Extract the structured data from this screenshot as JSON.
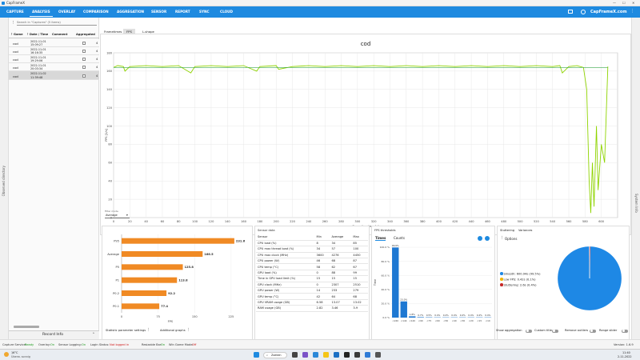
{
  "window_title": "CapFrameX",
  "nav": {
    "tabs": [
      "CAPTURE",
      "ANALYSIS",
      "OVERLAY",
      "COMPARISON",
      "AGGREGATION",
      "SENSOR",
      "REPORT",
      "SYNC",
      "CLOUD"
    ],
    "active": "ANALYSIS",
    "brand": "CapFrameX.com"
  },
  "left": {
    "search_placeholder": "Search in \"Captures\" (5 items)",
    "columns": [
      "Game",
      "Date / Time",
      "Comment",
      "Aggregated"
    ],
    "rows": [
      {
        "game": "cod",
        "date": "2022-11-01",
        "time": "15:09:27",
        "n": "4"
      },
      {
        "game": "cod",
        "date": "2022-11-01",
        "time": "16:16:35",
        "n": "4"
      },
      {
        "game": "cod",
        "date": "2022-11-01",
        "time": "19:29:06",
        "n": "4"
      },
      {
        "game": "cod",
        "date": "2022-11-01",
        "time": "20:03:34",
        "n": "4"
      },
      {
        "game": "cod",
        "date": "2022-11-02",
        "time": "11:39:48",
        "n": "4"
      }
    ],
    "record_info": "Record Info",
    "observed_label": "Observed directory"
  },
  "right_strip": "System Info",
  "graph": {
    "tabs": [
      "Frametimes",
      "FPS",
      "L-shape"
    ],
    "active_tab": "FPS",
    "title": "cod",
    "filter_label": "Filter mode",
    "filter_value": "Average"
  },
  "chart_data": [
    {
      "type": "line",
      "title": "cod",
      "xlabel": "Recording time [s]",
      "ylabel": "FPS [1/s]",
      "xlim": [
        0,
        620
      ],
      "ylim": [
        0,
        180
      ],
      "xticks": [
        0,
        20,
        40,
        60,
        80,
        100,
        120,
        140,
        160,
        180,
        200,
        220,
        240,
        260,
        280,
        300,
        320,
        340,
        360,
        380,
        400,
        420,
        440,
        460,
        480,
        500,
        520,
        540,
        560,
        580,
        600
      ],
      "yticks": [
        0,
        20,
        40,
        60,
        80,
        100,
        120,
        140,
        160,
        180
      ],
      "series": [
        {
          "name": "FPS",
          "color": "#8fd400",
          "x": [
            0,
            5,
            12,
            14,
            20,
            40,
            60,
            80,
            95,
            100,
            120,
            140,
            160,
            176,
            180,
            200,
            203,
            220,
            240,
            260,
            280,
            300,
            320,
            340,
            360,
            380,
            400,
            420,
            440,
            460,
            480,
            500,
            520,
            540,
            549,
            552,
            560,
            570,
            578,
            582,
            585,
            587,
            589,
            591,
            594,
            596,
            600,
            604,
            608
          ],
          "y": [
            164,
            166,
            165,
            160,
            165,
            166,
            165,
            166,
            158,
            165,
            166,
            165,
            166,
            160,
            165,
            166,
            162,
            165,
            166,
            165,
            166,
            165,
            166,
            165,
            166,
            165,
            166,
            165,
            166,
            165,
            166,
            165,
            166,
            165,
            166,
            158,
            165,
            166,
            164,
            140,
            40,
            5,
            60,
            12,
            100,
            30,
            80,
            60,
            165
          ]
        },
        {
          "name": "Avg FPS",
          "color": "#3aa84a",
          "x": [
            0,
            608
          ],
          "y": [
            164,
            164
          ]
        }
      ],
      "legend": "bottom-right"
    },
    {
      "type": "bar",
      "categories": [
        "P95",
        "Average",
        "P5",
        "P1",
        "P0.2",
        "P0.1"
      ],
      "values": [
        231.6,
        166.5,
        125.8,
        113.8,
        92.2,
        77.4
      ],
      "xticks": [
        0,
        75,
        150,
        225
      ],
      "xlim": [
        0,
        240
      ],
      "color": "#f08a24"
    },
    {
      "type": "bar",
      "title": "FPS thresholds",
      "ylabel": "Time",
      "categories": [
        "<240",
        "<144",
        "<120",
        "<90",
        "<75",
        "<60",
        "<50",
        "<40",
        "<30",
        "<20",
        "<15",
        "<10"
      ],
      "values": [
        99.6,
        23.0,
        1.8,
        0.7,
        0.5,
        0.4,
        0.4,
        0.4,
        0.4,
        0.4,
        0.4,
        0.4
      ],
      "labels": [
        "99.6%",
        "23.0%",
        "1.8%",
        "0.7%",
        "0.5%",
        "0.4%",
        "0.4%",
        "0.4%",
        "0.4%",
        "0.4%",
        "0.4%",
        "0.4%"
      ],
      "yticks": [
        "100.0 %",
        "80.0 %",
        "60.0 %",
        "40.0 %",
        "20.0 %",
        "0.0 %"
      ],
      "ylim": [
        0,
        100
      ],
      "color": "#1e78d2"
    },
    {
      "type": "pie",
      "slices": [
        {
          "label": "Smooth",
          "value": 99.5,
          "text": "Smooth: 600.94s (99.5%)",
          "color": "#1e88e5"
        },
        {
          "label": "Low FPS",
          "value": 0.1,
          "text": "Low FPS: 0.42s (0.1%)",
          "color": "#f2b600"
        },
        {
          "label": "Stuttering",
          "value": 0.4,
          "text": "Stuttering: 2.6s (0.4%)",
          "color": "#c62828"
        }
      ]
    }
  ],
  "percent_axis_label": "FPS",
  "sensor": {
    "title": "Sensor data",
    "columns": [
      "Sensor",
      "Min",
      "Average",
      "Max"
    ],
    "rows": [
      [
        "CPU load (%)",
        "8",
        "34",
        "85"
      ],
      [
        "CPU max thread load (%)",
        "34",
        "57",
        "100"
      ],
      [
        "CPU max clock (MHz)",
        "3600",
        "4276",
        "4450"
      ],
      [
        "CPU power (W)",
        "46",
        "68",
        "87"
      ],
      [
        "CPU temp (°C)",
        "58",
        "62",
        "67"
      ],
      [
        "GPU load (%)",
        "0",
        "88",
        "99"
      ],
      [
        "Time in GPU load limit (%)",
        "15",
        "15",
        "15"
      ],
      [
        "GPU clock (MHz)",
        "0",
        "2307",
        "2510"
      ],
      [
        "GPU power (W)",
        "14",
        "233",
        "279"
      ],
      [
        "GPU temp (°C)",
        "42",
        "64",
        "68"
      ],
      [
        "GPU VRAM usage (GB)",
        "6.58",
        "13.07",
        "13.02"
      ],
      [
        "RAM usage (GB)",
        "2.82",
        "3.46",
        "3.9"
      ]
    ]
  },
  "thresholds": {
    "title": "FPS thresholds",
    "tabs": [
      "Times",
      "Counts"
    ]
  },
  "stutter": {
    "tabs": [
      "Stuttering",
      "Variances"
    ],
    "options": "Options"
  },
  "bottom_bar": {
    "stat_settings": "Statistic parameter settings",
    "additional_graphs": "Additional graphs",
    "show_aggregation": "Show aggregation",
    "custom_title": "Custom title",
    "remove_outliers": "Remove outliers",
    "range_slider": "Range slider"
  },
  "status": {
    "capture_service": "Capture Service:",
    "capture_val": "Ready",
    "overlay": "Overlay:",
    "overlay_val": "On",
    "sensor_logging": "Sensor Logging:",
    "sensor_val": "On",
    "login": "Login Status:",
    "login_val": "Not logged in",
    "rebar": "Resizable Bar:",
    "rebar_val": "On",
    "gamemode": "Win Game Mode:",
    "gamemode_val": "Off",
    "version": "Version: 1.6.9"
  },
  "taskbar": {
    "weather_temp": "16°C",
    "weather_text": "Überw. sonnig",
    "search": "Zoeken",
    "time": "11:40",
    "date": "2-11-2022"
  },
  "colors": {
    "nav": "#1e8ae0",
    "accent_orange": "#f08a24",
    "line_green": "#8fd400"
  }
}
